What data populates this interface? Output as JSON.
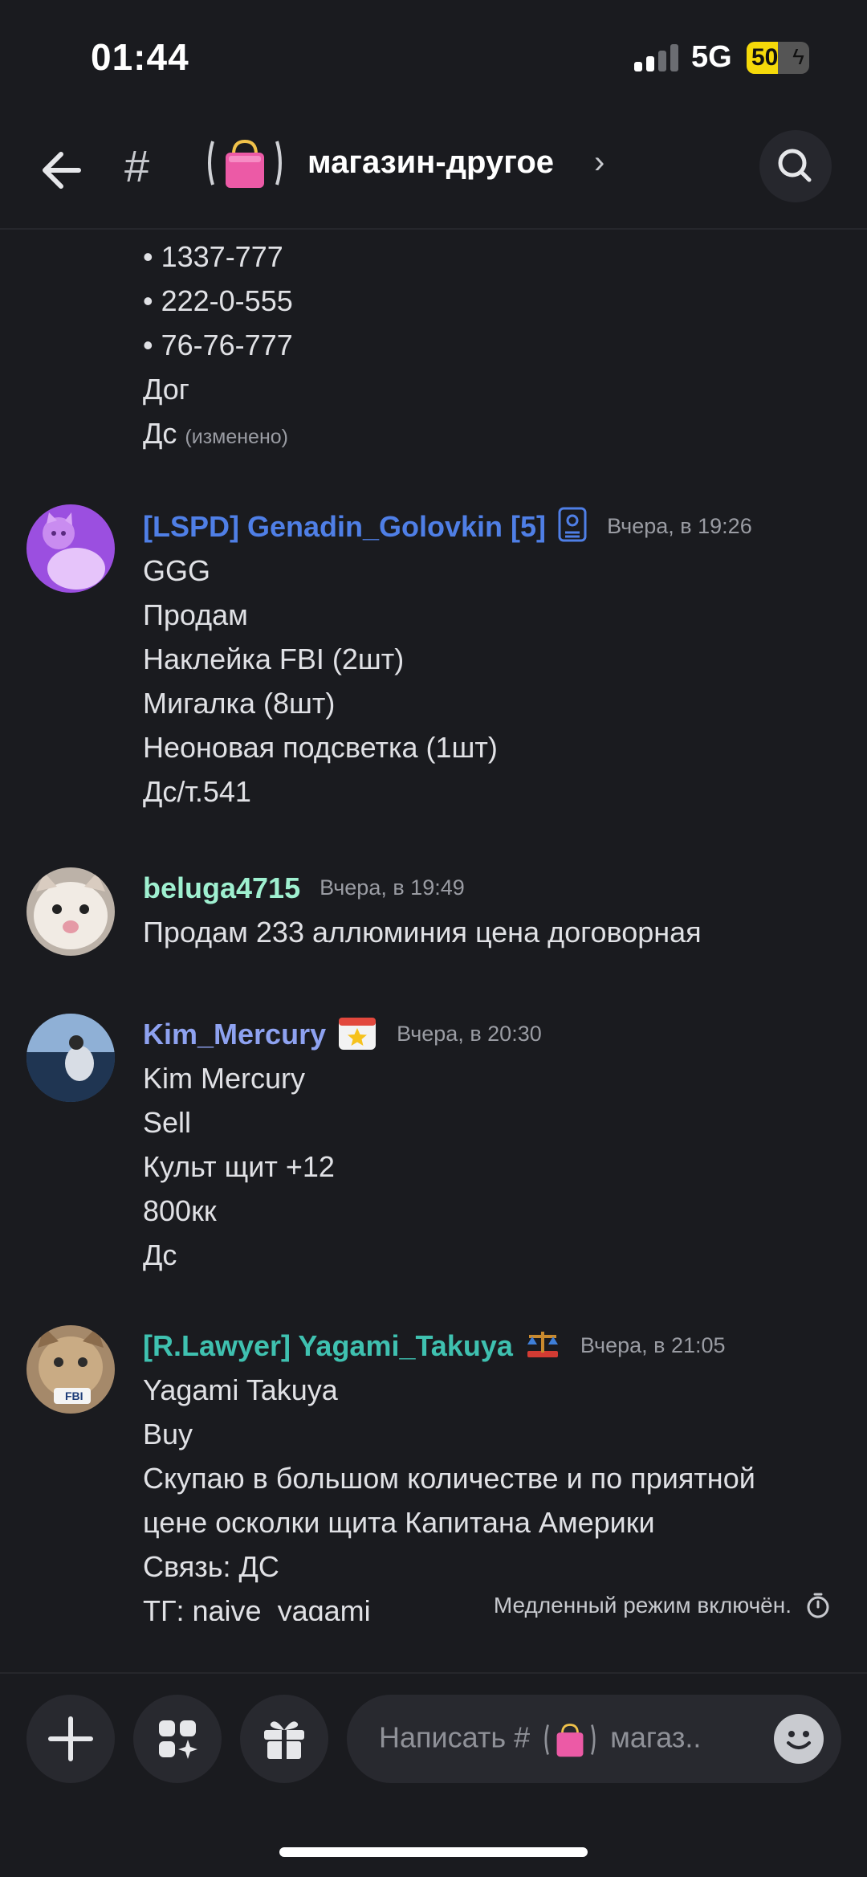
{
  "status": {
    "time": "01:44",
    "network": "5G",
    "battery": "50",
    "battery_level": 0.5
  },
  "header": {
    "channel_name": "магазин-другое",
    "chevron": "›"
  },
  "top_message": {
    "lines": [
      "• 1337-777",
      "• 222-0-555",
      "• 76-76-777",
      "Дог",
      "Дс"
    ],
    "edited": "(изменено)"
  },
  "messages": [
    {
      "author": "[LSPD] Genadin_Golovkin [5]",
      "color": "#4f7fe6",
      "time": "Вчера, в 19:26",
      "role_icon": "police-badge-icon",
      "lines": [
        "GGG",
        "Продам",
        "Наклейка FBI (2шт)",
        "Мигалка (8шт)",
        "Неоновая подсветка (1шт)",
        "Дс/т.541"
      ]
    },
    {
      "author": "beluga4715",
      "color": "#9ff0d0",
      "time": "Вчера, в 19:49",
      "lines": [
        "Продам 233 аллюминия цена договорная"
      ]
    },
    {
      "author": "Kim_Mercury",
      "color": "#8ea2f0",
      "time": "Вчера, в 20:30",
      "role_icon": "calendar-star-icon",
      "lines": [
        "Kim Mercury",
        "Sell",
        "Культ щит +12",
        "800кк",
        "Дс"
      ]
    },
    {
      "author": "[R.Lawyer] Yagami_Takuya",
      "color": "#3fc1b0",
      "time": "Вчера, в 21:05",
      "role_icon": "scales-icon",
      "lines": [
        "Yagami Takuya",
        "Buy",
        "Скупаю в большом количестве и по приятной",
        "цене осколки щита Капитана Америки",
        "Связь: ДС",
        "ТГ: naive_yagami"
      ]
    }
  ],
  "slow_mode": "Медленный режим включён.",
  "composer": {
    "placeholder_prefix": "Написать #",
    "placeholder_suffix": "магаз.."
  }
}
